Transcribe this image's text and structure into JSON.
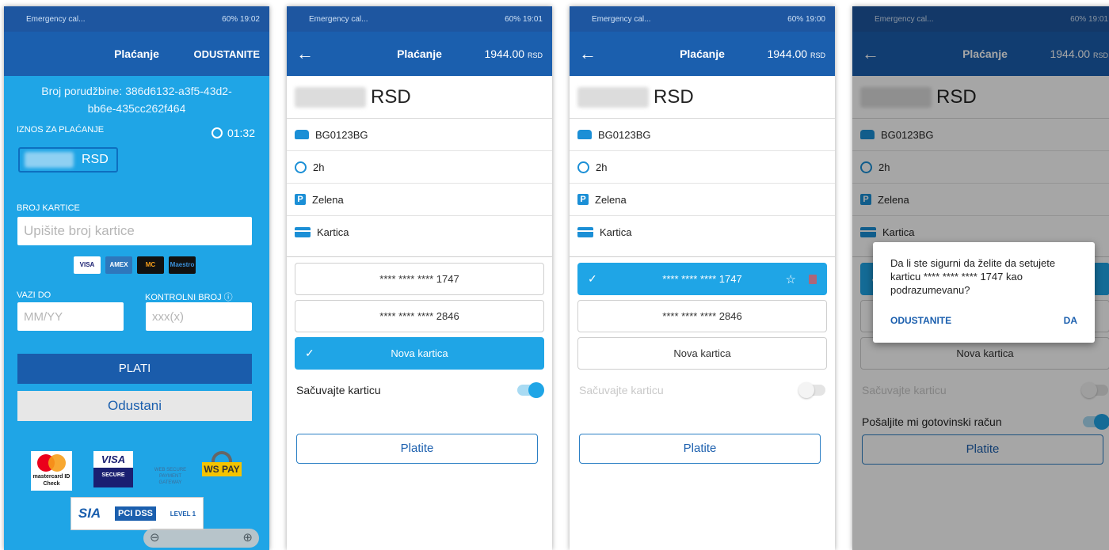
{
  "status_bar": {
    "carrier": "Emergency cal...",
    "p1_time": "60% 19:02",
    "p2_time": "60% 19:01",
    "p3_time": "60% 19:00",
    "p4_time": "60% 19:01"
  },
  "screen1": {
    "title": "Plaćanje",
    "cancel": "ODUSTANITE",
    "order_label": "Broj porudžbine: 386d6132-a3f5-43d2-bb6e-435cc262f464",
    "amount_label": "IZNOS ZA PLAĆANJE",
    "timer": "01:32",
    "currency": "RSD",
    "card_number_label": "BROJ KARTICE",
    "card_number_placeholder": "Upišite broj kartice",
    "card_logos": [
      "VISA",
      "AMEX",
      "MC",
      "Maestro"
    ],
    "valid_label": "VAZI DO",
    "valid_placeholder": "MM/YY",
    "cvv_label": "KONTROLNI BROJ",
    "cvv_placeholder": "xxx(x)",
    "pay_button": "PLATI",
    "cancel_button": "Odustani",
    "badges": {
      "mastercard": "mastercard ID Check",
      "visa": "VISA",
      "visa_sub": "SECURE",
      "gateway": "WEB SECURE PAYMENT GATEWAY",
      "wspay": "WS PAY",
      "sia": "SIA",
      "pci": "PCI DSS",
      "pci_level": "LEVEL 1"
    }
  },
  "screen_common": {
    "title": "Plaćanje",
    "amount_right": "1944.00",
    "amount_right_unit": "RSD",
    "currency": "RSD",
    "plate": "BG0123BG",
    "duration": "2h",
    "zone": "Zelena",
    "method": "Kartica",
    "card1": "**** **** **** 1747",
    "card2": "**** **** **** 2846",
    "new_card": "Nova kartica",
    "save_card": "Sačuvajte karticu",
    "pay": "Platite"
  },
  "screen4": {
    "send_receipt": "Pošaljite mi gotovinski račun",
    "dialog_message": "Da li ste sigurni da želite da setujete karticu **** **** **** 1747 kao podrazumevanu?",
    "dialog_cancel": "ODUSTANITE",
    "dialog_ok": "DA"
  },
  "colors": {
    "primary_dark": "#1b5fae",
    "primary_light": "#1fa5e6"
  }
}
